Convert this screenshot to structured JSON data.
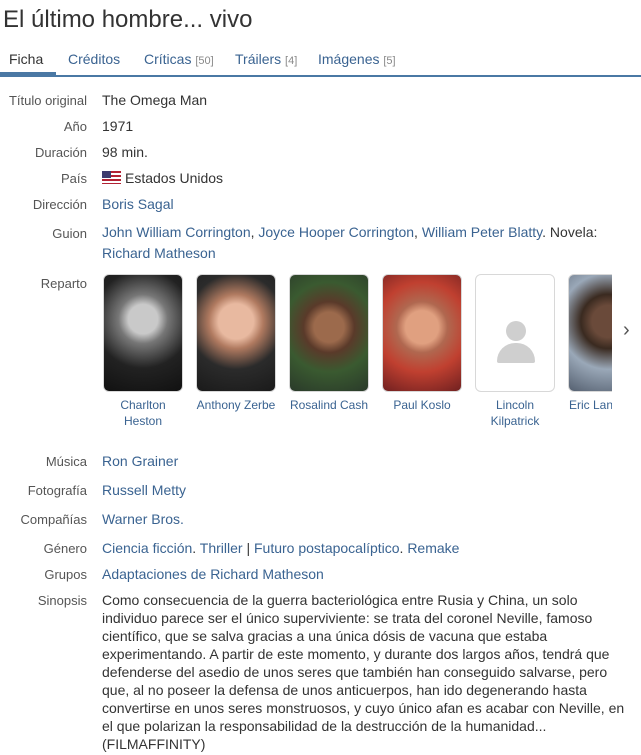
{
  "title": "El último hombre... vivo",
  "tabs": [
    {
      "label": "Ficha",
      "count": ""
    },
    {
      "label": "Créditos",
      "count": ""
    },
    {
      "label": "Críticas",
      "count": "[50]"
    },
    {
      "label": "Tráilers",
      "count": "[4]"
    },
    {
      "label": "Imágenes",
      "count": "[5]"
    }
  ],
  "fields": {
    "original_title": {
      "label": "Título original",
      "value": "The Omega Man"
    },
    "year": {
      "label": "Año",
      "value": "1971"
    },
    "duration": {
      "label": "Duración",
      "value": "98 min."
    },
    "country": {
      "label": "País",
      "value": "Estados Unidos"
    },
    "director": {
      "label": "Dirección",
      "value": "Boris Sagal"
    },
    "screenplay": {
      "label": "Guion",
      "w1": "John William Corrington",
      "w2": "Joyce Hooper Corrington",
      "w3": "William Peter Blatty",
      "novel_prefix": ". Novela:",
      "novelist": "Richard Matheson"
    },
    "cast_label": "Reparto",
    "music": {
      "label": "Música",
      "value": "Ron Grainer"
    },
    "photography": {
      "label": "Fotografía",
      "value": "Russell Metty"
    },
    "companies": {
      "label": "Compañías",
      "value": "Warner Bros."
    },
    "genre": {
      "label": "Género",
      "g1": "Ciencia ficción",
      "g2": "Thriller",
      "sep": "|",
      "g3": "Futuro postapocalíptico",
      "g4": "Remake"
    },
    "groups": {
      "label": "Grupos",
      "value": "Adaptaciones de Richard Matheson"
    },
    "synopsis": {
      "label": "Sinopsis",
      "value": "Como consecuencia de la guerra bacteriológica entre Rusia y China, un solo individuo parece ser el único superviviente: se trata del coronel Neville, famoso científico, que se salva gracias a una única dósis de vacuna que estaba experimentando. A partir de este momento, y durante dos largos años, tendrá que defenderse del asedio de unos seres que también han conseguido salvarse, pero que, al no poseer la defensa de unos anticuerpos, han ido degenerando hasta convertirse en unos seres monstruosos, y cuyo único afan es acabar con Neville, en el que polarizan la responsabilidad de la destrucción de la humanidad... (FILMAFFINITY)"
    }
  },
  "cast": [
    {
      "line1": "Charlton",
      "line2": "Heston"
    },
    {
      "line1": "Anthony Zerbe",
      "line2": ""
    },
    {
      "line1": "Rosalind Cash",
      "line2": ""
    },
    {
      "line1": "Paul Koslo",
      "line2": ""
    },
    {
      "line1": "Lincoln",
      "line2": "Kilpatrick"
    },
    {
      "line1": "Eric Lan",
      "line2": ""
    }
  ],
  "icons": {
    "next": "chevron-right-icon",
    "flag": "us-flag-icon",
    "placeholder": "person-placeholder-icon"
  },
  "colors": {
    "link": "#3a6391",
    "accent": "#4a78a4"
  }
}
